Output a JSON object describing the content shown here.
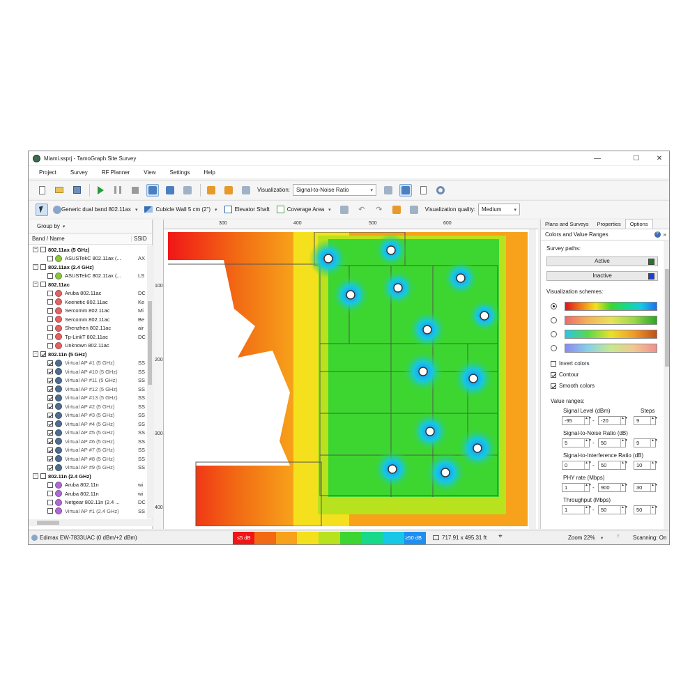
{
  "window": {
    "title": "Miami.ssprj - TamoGraph Site Survey"
  },
  "menu": [
    "Project",
    "Survey",
    "RF Planner",
    "View",
    "Settings",
    "Help"
  ],
  "toolbar1": {
    "visualization_label": "Visualization:",
    "visualization_value": "Signal-to-Noise Ratio"
  },
  "toolbar2": {
    "ap_tool": "Generic dual band 802.11ax",
    "wall_tool": "Cubicle Wall 5 cm (2\")",
    "elevator": "Elevator Shaft",
    "coverage": "Coverage Area",
    "quality_label": "Visualization quality:",
    "quality_value": "Medium"
  },
  "left": {
    "groupby": "Group by",
    "col_name": "Band / Name",
    "col_ssid": "SSID",
    "rows": [
      {
        "t": "g",
        "label": "802.11ax (5 GHz)",
        "exp": "−",
        "cb": false
      },
      {
        "t": "i",
        "label": "ASUSTekC 802.11ax (...",
        "ssid": "AX",
        "cb": false,
        "color": "#8cc63f",
        "gray": false
      },
      {
        "t": "g",
        "label": "802.11ax (2.4 GHz)",
        "exp": "−",
        "cb": false
      },
      {
        "t": "i",
        "label": "ASUSTekC 802.11ax (...",
        "ssid": "LS",
        "cb": false,
        "color": "#8cc63f",
        "gray": false
      },
      {
        "t": "g",
        "label": "802.11ac",
        "exp": "−",
        "cb": false
      },
      {
        "t": "i",
        "label": "Aruba 802.11ac",
        "ssid": "DC",
        "cb": false,
        "color": "#e26464",
        "gray": false
      },
      {
        "t": "i",
        "label": "Keenetic 802.11ac",
        "ssid": "Ke",
        "cb": false,
        "color": "#e26464",
        "gray": false
      },
      {
        "t": "i",
        "label": "Sercomm 802.11ac",
        "ssid": "Mi",
        "cb": false,
        "color": "#e26464",
        "gray": false
      },
      {
        "t": "i",
        "label": "Sercomm 802.11ac",
        "ssid": "Be",
        "cb": false,
        "color": "#e26464",
        "gray": false
      },
      {
        "t": "i",
        "label": "Shenzhen 802.11ac",
        "ssid": "air",
        "cb": false,
        "color": "#e26464",
        "gray": false
      },
      {
        "t": "i",
        "label": "Tp-LinkT 802.11ac",
        "ssid": "DC",
        "cb": false,
        "color": "#e26464",
        "gray": false
      },
      {
        "t": "i",
        "label": "Unknown 802.11ac",
        "ssid": "",
        "cb": false,
        "color": "#e26464",
        "gray": false
      },
      {
        "t": "g",
        "label": "802.11n (5 GHz)",
        "exp": "−",
        "cb": true
      },
      {
        "t": "i",
        "label": "Virtual AP #1 (5 GHz)",
        "ssid": "SS",
        "cb": true,
        "color": "#4f6d8f",
        "gray": true
      },
      {
        "t": "i",
        "label": "Virtual AP #10 (5 GHz)",
        "ssid": "SS",
        "cb": true,
        "color": "#4f6d8f",
        "gray": true
      },
      {
        "t": "i",
        "label": "Virtual AP #11 (5 GHz)",
        "ssid": "SS",
        "cb": true,
        "color": "#4f6d8f",
        "gray": true
      },
      {
        "t": "i",
        "label": "Virtual AP #12 (5 GHz)",
        "ssid": "SS",
        "cb": true,
        "color": "#4f6d8f",
        "gray": true
      },
      {
        "t": "i",
        "label": "Virtual AP #13 (5 GHz)",
        "ssid": "SS",
        "cb": true,
        "color": "#4f6d8f",
        "gray": true
      },
      {
        "t": "i",
        "label": "Virtual AP #2 (5 GHz)",
        "ssid": "SS",
        "cb": true,
        "color": "#4f6d8f",
        "gray": true
      },
      {
        "t": "i",
        "label": "Virtual AP #3 (5 GHz)",
        "ssid": "SS",
        "cb": true,
        "color": "#4f6d8f",
        "gray": true
      },
      {
        "t": "i",
        "label": "Virtual AP #4 (5 GHz)",
        "ssid": "SS",
        "cb": true,
        "color": "#4f6d8f",
        "gray": true
      },
      {
        "t": "i",
        "label": "Virtual AP #5 (5 GHz)",
        "ssid": "SS",
        "cb": true,
        "color": "#4f6d8f",
        "gray": true
      },
      {
        "t": "i",
        "label": "Virtual AP #6 (5 GHz)",
        "ssid": "SS",
        "cb": true,
        "color": "#4f6d8f",
        "gray": true
      },
      {
        "t": "i",
        "label": "Virtual AP #7 (5 GHz)",
        "ssid": "SS",
        "cb": true,
        "color": "#4f6d8f",
        "gray": true
      },
      {
        "t": "i",
        "label": "Virtual AP #8 (5 GHz)",
        "ssid": "SS",
        "cb": true,
        "color": "#4f6d8f",
        "gray": true
      },
      {
        "t": "i",
        "label": "Virtual AP #9 (5 GHz)",
        "ssid": "SS",
        "cb": true,
        "color": "#4f6d8f",
        "gray": true
      },
      {
        "t": "g",
        "label": "802.11n (2.4 GHz)",
        "exp": "−",
        "cb": false
      },
      {
        "t": "i",
        "label": "Aruba 802.11n",
        "ssid": "wi",
        "cb": false,
        "color": "#b06ad4",
        "gray": false
      },
      {
        "t": "i",
        "label": "Aruba 802.11n",
        "ssid": "wi",
        "cb": false,
        "color": "#b06ad4",
        "gray": false
      },
      {
        "t": "i",
        "label": "Netgear 802.11n (2.4 ...",
        "ssid": "DC",
        "cb": false,
        "color": "#b06ad4",
        "gray": false
      },
      {
        "t": "i",
        "label": "Virtual AP #1 (2.4 GHz)",
        "ssid": "SS",
        "cb": false,
        "color": "#b06ad4",
        "gray": true
      }
    ]
  },
  "map": {
    "ruler_top": [
      "300",
      "400",
      "500",
      "600"
    ],
    "ruler_left": [
      "100",
      "200",
      "300",
      "400"
    ],
    "access_points": 13
  },
  "right": {
    "tabs": [
      "Plans and Surveys",
      "Properties",
      "Options"
    ],
    "active_tab": "Options",
    "panel_title": "Colors and Value Ranges",
    "survey_paths_label": "Survey paths:",
    "active_btn": "Active",
    "active_color": "#1f7a1f",
    "inactive_btn": "Inactive",
    "inactive_color": "#1f3fcf",
    "schemes_label": "Visualization schemes:",
    "invert_colors": "Invert colors",
    "contour": "Contour",
    "smooth_colors": "Smooth colors",
    "value_ranges": "Value ranges:",
    "signal_level": {
      "label": "Signal Level (dBm)",
      "min": "-95",
      "max": "-20",
      "steps": "9"
    },
    "steps_label": "Steps",
    "snr": {
      "label": "Signal-to-Noise Ratio (dB)",
      "min": "5",
      "max": "50",
      "steps": "9"
    },
    "sir": {
      "label": "Signal-to-Interference Ratio (dB)",
      "min": "0",
      "max": "50",
      "steps": "10"
    },
    "phy": {
      "label": "PHY rate (Mbps)",
      "min": "1",
      "max": "900",
      "steps": "30"
    },
    "throughput": {
      "label": "Throughput (Mbps)",
      "min": "1",
      "max": "50",
      "steps": "50"
    }
  },
  "status": {
    "adapter": "Edimax EW-7833UAC (0 dBm/+2 dBm)",
    "legend_min": "≤5 dB",
    "legend_max": "≥50 dB",
    "legend_colors": [
      "#f01616",
      "#f26a14",
      "#f7a21a",
      "#f5e01e",
      "#b8e21e",
      "#3dd630",
      "#16d98a",
      "#16c7e6",
      "#1e8ff0"
    ],
    "dimensions": "717.91 x 495.31 ft",
    "zoom": "Zoom 22%",
    "scanning": "Scanning: On"
  }
}
